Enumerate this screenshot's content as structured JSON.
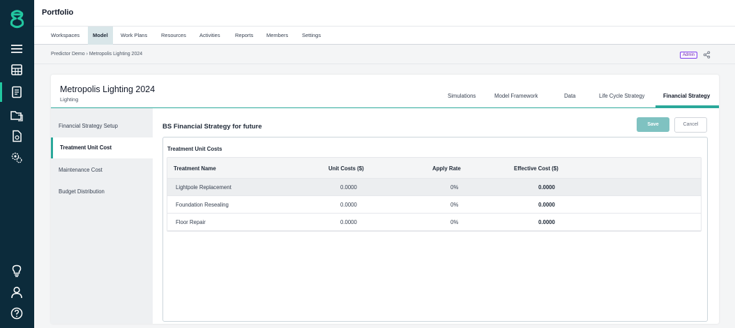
{
  "header": {
    "title": "Portfolio"
  },
  "topnav": [
    "Workspaces",
    "Model",
    "Work Plans",
    "Resources",
    "Activities",
    "Reports",
    "Members",
    "Settings"
  ],
  "breadcrumb": {
    "text": "Predictor Demo › Metropolis Lighting 2024"
  },
  "badge": {
    "label": "Admin"
  },
  "model": {
    "title": "Metropolis Lighting 2024",
    "subtitle": "Lighting"
  },
  "tabs": [
    "Simulations",
    "Model Framework",
    "Data",
    "Life Cycle Strategy",
    "Financial Strategy"
  ],
  "subnav": [
    "Financial Strategy Setup",
    "Treatment Unit Cost",
    "Maintenance Cost",
    "Budget Distribution"
  ],
  "content": {
    "title": "BS Financial Strategy for future",
    "save_label": "Save",
    "cancel_label": "Cancel",
    "panel_title": "Treatment Unit Costs"
  },
  "table": {
    "columns": [
      "Treatment Name",
      "Unit Costs ($)",
      "Apply Rate",
      "Effective Cost ($)"
    ],
    "rows": [
      [
        "Lightpole Replacement",
        "0.0000",
        "0%",
        "0.0000"
      ],
      [
        "Foundation Resealing",
        "0.0000",
        "0%",
        "0.0000"
      ],
      [
        "Floor Repair",
        "0.0000",
        "0%",
        "0.0000"
      ]
    ]
  },
  "colors": {
    "rail": "#0c2b3b",
    "accent": "#2aa89a",
    "save": "#7fc2c1",
    "nav_active": "#d9e6e9"
  },
  "icons": [
    "app-logo-icon",
    "menu-icon",
    "calculator-icon",
    "document-icon",
    "folders-icon",
    "file-report-icon",
    "settings-gear-icon",
    "lightbulb-icon",
    "user-icon",
    "help-icon",
    "share-icon"
  ]
}
